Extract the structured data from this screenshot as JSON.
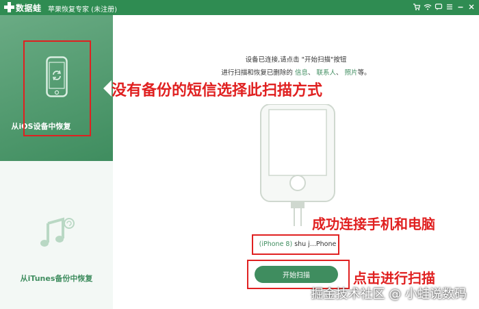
{
  "titlebar": {
    "app_name": "数据蛙",
    "subtitle": "苹果恢复专家 (未注册)",
    "controls": [
      "cart-icon",
      "wifi-icon",
      "feedback-icon",
      "menu-icon",
      "minimize-icon",
      "close-icon"
    ]
  },
  "sidebar": {
    "items": [
      {
        "label": "从iOS设备中恢复",
        "icon": "phone-restore-icon",
        "selected": true
      },
      {
        "label": "从iTunes备份中恢复",
        "icon": "music-note-icon",
        "selected": false
      }
    ]
  },
  "main": {
    "instruction_line1": "设备已连接,请点击 \"开始扫描\"按钮",
    "instruction_line2_prefix": "进行扫描和恢复已删除的",
    "instruction_links": [
      "信息",
      "联系人",
      "照片"
    ],
    "instruction_line2_suffix": "等。",
    "device_paren": "(iPhone 8)",
    "device_name": " shu j...Phone",
    "start_button": "开始扫描"
  },
  "annotations": {
    "a1": "没有备份的短信选择此扫描方式",
    "a2": "成功连接手机和电脑",
    "a3": "点击进行扫描"
  },
  "watermark": "掘金技术社区 @ 小蛙说数码",
  "colors": {
    "brand_green": "#3f8d5f",
    "title_green": "#2f8c52",
    "annotation_red": "#e02020"
  }
}
